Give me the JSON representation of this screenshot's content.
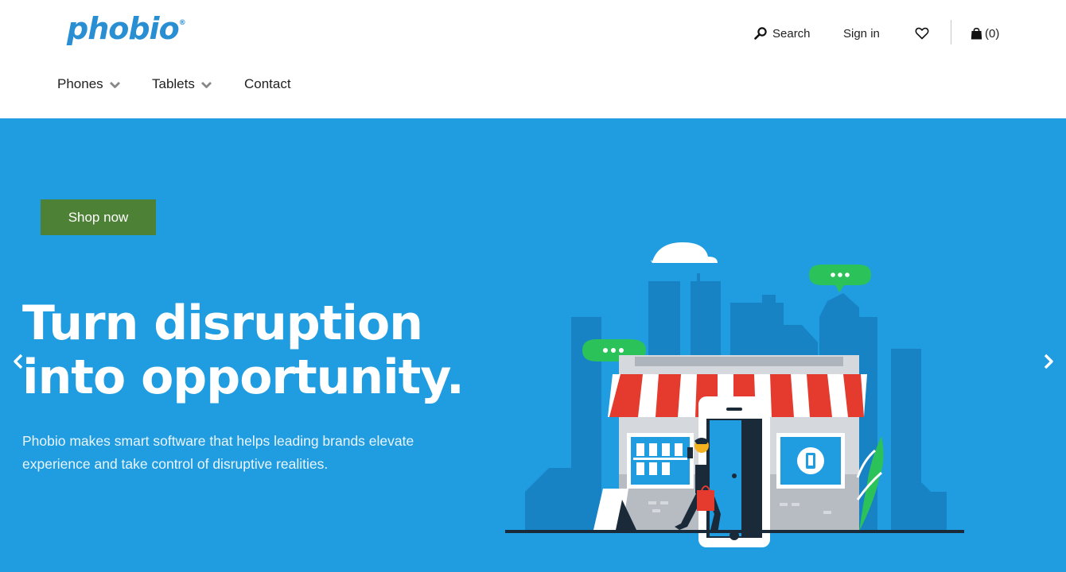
{
  "header": {
    "logo": "phobio",
    "logo_mark": "®",
    "search_label": "Search",
    "signin_label": "Sign in",
    "cart_count": "(0)"
  },
  "nav": {
    "items": [
      {
        "label": "Phones",
        "has_dropdown": true
      },
      {
        "label": "Tablets",
        "has_dropdown": true
      },
      {
        "label": "Contact",
        "has_dropdown": false
      }
    ]
  },
  "hero": {
    "button_label": "Shop now",
    "headline_line1": "Turn disruption",
    "headline_line2": "into opportunity.",
    "subtext": "Phobio makes smart software that helps leading brands elevate experience and take control of disruptive realities."
  },
  "icons": {
    "search": "search-icon",
    "wishlist": "heart-icon",
    "cart": "shopping-bag-icon",
    "prev": "chevron-left-icon",
    "next": "chevron-right-icon"
  },
  "colors": {
    "logo": "#2a8fd2",
    "hero_background": "#1f9de0",
    "shop_button": "#4d8136",
    "awning_red": "#e53b2f",
    "speech_bubble": "#2cc25a"
  }
}
